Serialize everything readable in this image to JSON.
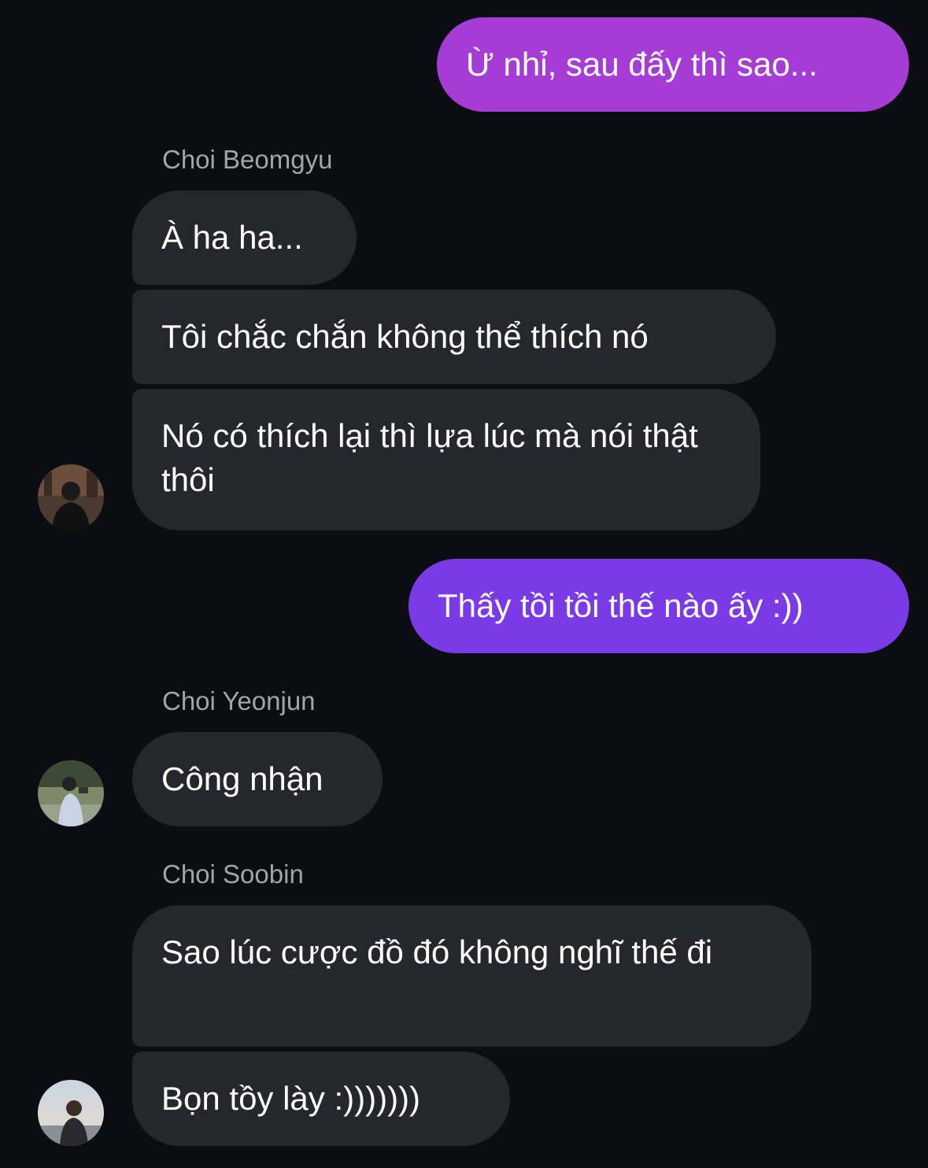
{
  "messages": [
    {
      "type": "sent",
      "text": "Ừ nhỉ, sau đấy thì sao...",
      "color": "#a23ad6"
    },
    {
      "type": "sender",
      "text": "Choi Beomgyu"
    },
    {
      "type": "received",
      "text": "À ha ha..."
    },
    {
      "type": "received",
      "text": "Tôi chắc chắn không thể thích nó"
    },
    {
      "type": "received",
      "text": "Nó có thích lại thì lựa lúc mà nói thật thôi"
    },
    {
      "type": "sent",
      "text": "Thấy tồi tồi thế nào ấy :))",
      "color": "#7b3ae4"
    },
    {
      "type": "sender",
      "text": "Choi Yeonjun"
    },
    {
      "type": "received",
      "text": "Công nhận"
    },
    {
      "type": "sender",
      "text": "Choi Soobin"
    },
    {
      "type": "received",
      "text": "Sao lúc cược đồ đó không nghĩ thế đi"
    },
    {
      "type": "received",
      "text": "Bọn tồy lày :)))))))"
    }
  ],
  "avatars": [
    {
      "name": "avatar-choi-beomgyu",
      "icon": "profile-photo"
    },
    {
      "name": "avatar-choi-yeonjun",
      "icon": "profile-photo"
    },
    {
      "name": "avatar-choi-soobin",
      "icon": "profile-photo"
    }
  ],
  "colors": {
    "background": "#0b0d12",
    "received_bubble": "#25272d",
    "sender_name": "#a0a4ad",
    "sent_gradient_top": "#a23ad6",
    "sent_gradient_bottom": "#7b3ae4"
  }
}
